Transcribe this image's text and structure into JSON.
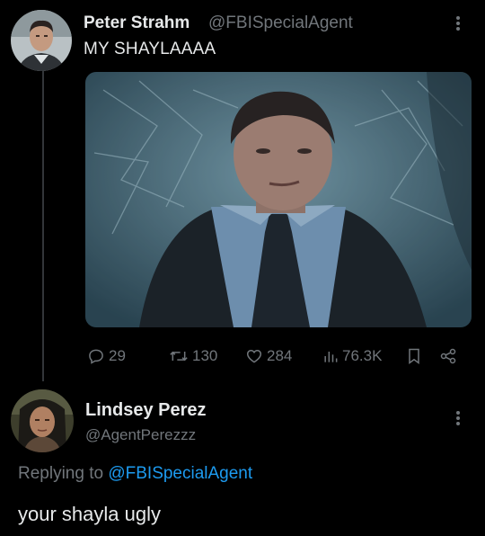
{
  "tweet": {
    "author_name": "Peter Strahm",
    "author_handle": "@FBISpecialAgent",
    "text": "MY SHAYLAAAA",
    "stats": {
      "replies": "29",
      "retweets": "130",
      "likes": "284",
      "views": "76.3K"
    }
  },
  "reply": {
    "author_name": "Lindsey Perez",
    "author_handle": "@AgentPerezzz",
    "replying_prefix": "Replying to",
    "replying_to": "@FBISpecialAgent",
    "text": "your shayla ugly"
  },
  "icons": {
    "reply": "reply-icon",
    "retweet": "retweet-icon",
    "like": "heart-icon",
    "views": "views-icon",
    "bookmark": "bookmark-icon",
    "share": "share-icon",
    "more": "more-icon"
  },
  "colors": {
    "background": "#000000",
    "text": "#e7e9ea",
    "muted": "#71767b",
    "link": "#1d9bf0"
  }
}
